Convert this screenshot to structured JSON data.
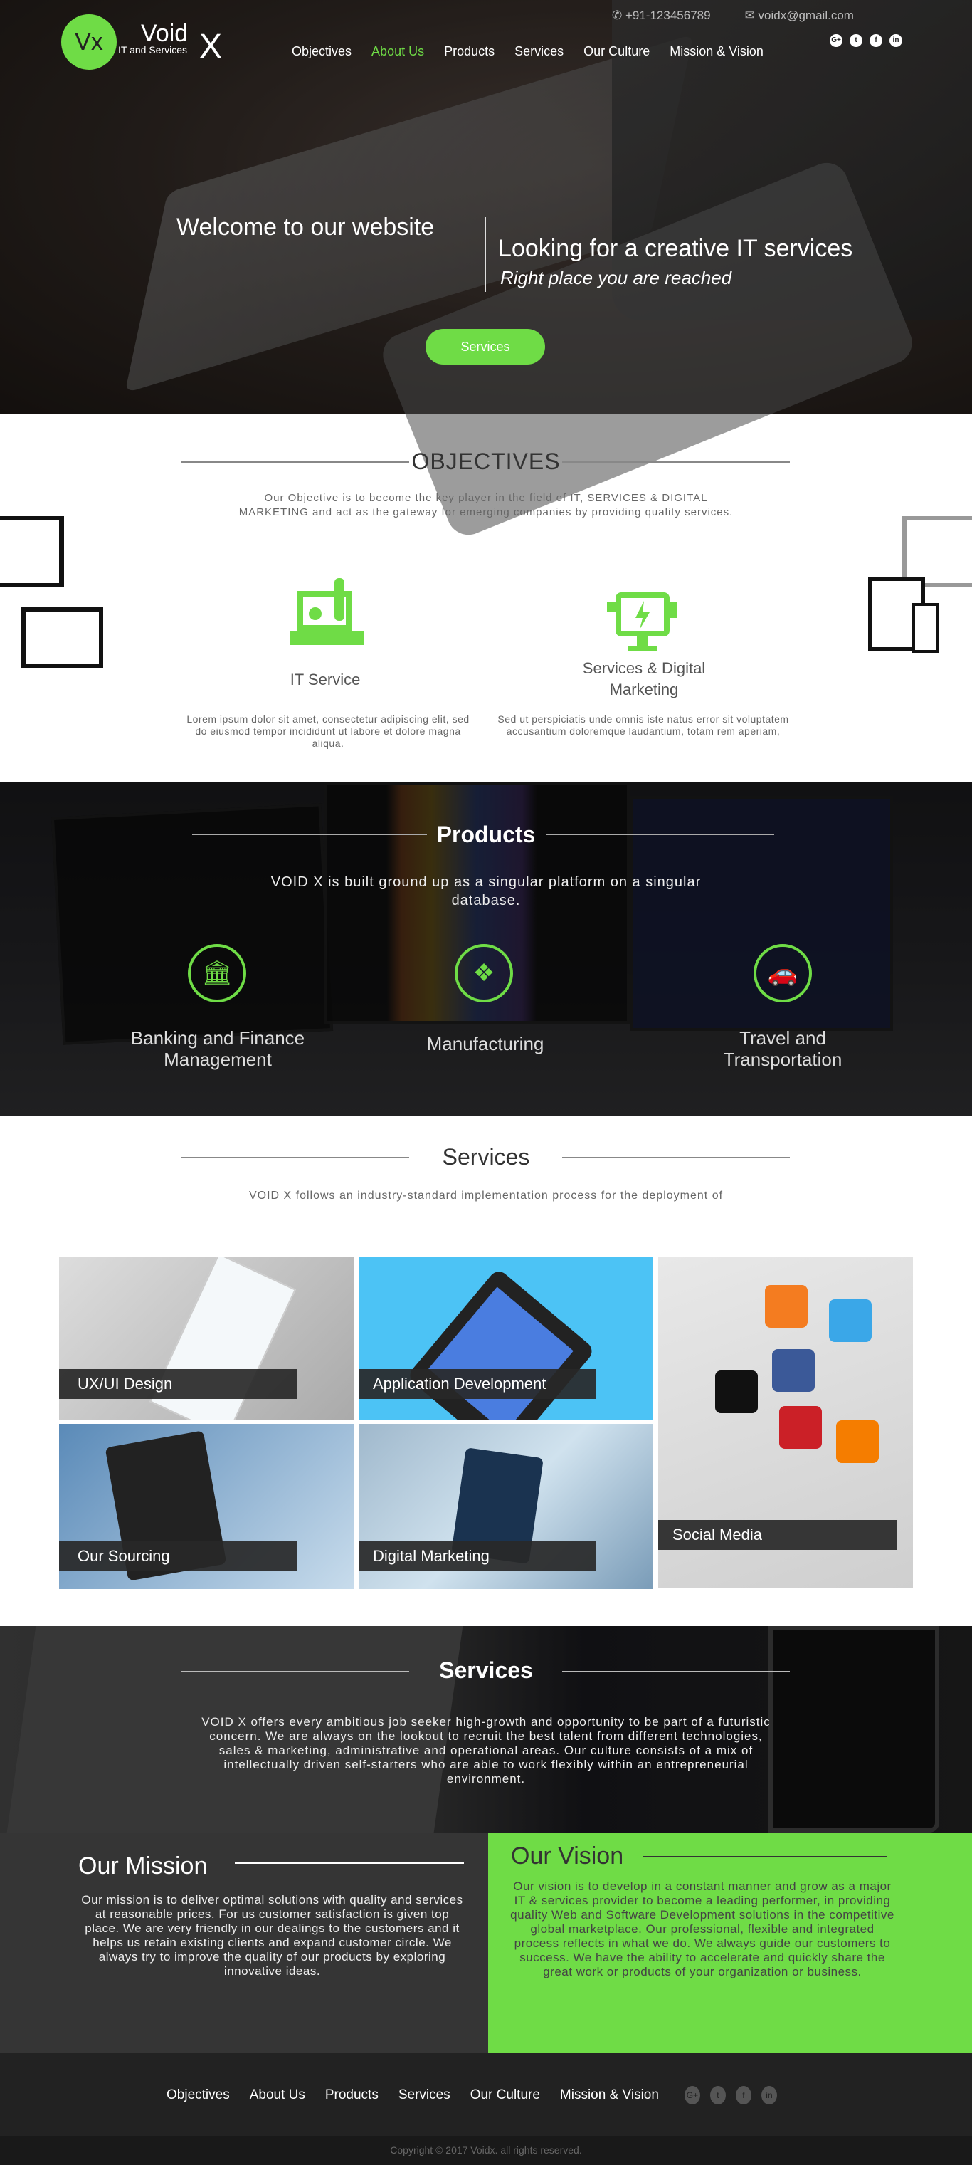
{
  "brand": {
    "logo_mark": "Vx",
    "name": "Void",
    "tagline": "IT and Services",
    "x": "X",
    "accent": "#6fdc46"
  },
  "contact": {
    "phone": "+91-123456789",
    "email": "voidx@gmail.com"
  },
  "nav": {
    "items": [
      "Objectives",
      "About Us",
      "Products",
      "Services",
      "Our Culture",
      "Mission & Vision"
    ],
    "active": "About Us"
  },
  "socials": [
    "G+",
    "t",
    "f",
    "in"
  ],
  "hero": {
    "welcome": "Welcome to our website",
    "headline": "Looking for a creative IT services",
    "subheadline": "Right place you are reached",
    "button": "Services"
  },
  "objectives": {
    "title": "OBJECTIVES",
    "text": "Our Objective is to become the key player in the field of IT, SERVICES & DIGITAL MARKETING and act as the gateway for emerging companies by providing quality services.",
    "items": [
      {
        "title": "IT Service",
        "text": "Lorem ipsum dolor sit amet, consectetur adipiscing elit, sed do eiusmod tempor incididunt ut labore et dolore magna aliqua.",
        "icon": "laptop-wrench-icon"
      },
      {
        "title": "Services & Digital Marketing",
        "text": "Sed ut perspiciatis unde omnis iste natus error sit voluptatem accusantium doloremque laudantium, totam rem aperiam,",
        "icon": "monitor-cart-mail-icon"
      }
    ]
  },
  "products": {
    "title": "Products",
    "text": "VOID X is built ground up as a singular platform on a singular database.",
    "items": [
      {
        "label": "Banking and Finance Management",
        "icon": "bank-icon"
      },
      {
        "label": "Manufacturing",
        "icon": "cubes-icon"
      },
      {
        "label": "Travel and Transportation",
        "icon": "car-icon"
      }
    ]
  },
  "services": {
    "title": "Services",
    "text": "VOID X follows an industry-standard implementation process for the deployment of",
    "tiles": [
      "UX/UI Design",
      "Application Development",
      "Social Media",
      "Our Sourcing",
      "Digital Marketing"
    ]
  },
  "culture": {
    "title": "Services",
    "text": "VOID X offers every ambitious job seeker high-growth and opportunity to be part of a futuristic concern. We are always on the lookout to recruit the best talent from different technologies, sales & marketing, administrative and operational areas. Our culture consists of a mix of intellectually driven self-starters who are able to work flexibly within an entrepreneurial environment."
  },
  "mission": {
    "title": "Our Mission",
    "text": "Our mission is to deliver optimal solutions with quality and services at reasonable prices. For us customer satisfaction is given top place. We are very friendly in our dealings to the customers and it helps us retain existing clients and expand customer circle. We always try to improve the quality of our products by exploring innovative ideas."
  },
  "vision": {
    "title": "Our Vision",
    "text": "Our vision is to develop in a constant manner and grow as a major IT & services provider to become a leading performer, in providing quality Web and Software Development solutions in the competitive global marketplace. Our professional, flexible and integrated process reflects in what we do. We always guide our customers to success. We have the ability to accelerate and quickly share the great work or products of your organization or business."
  },
  "footer": {
    "copyright": "Copyright © 2017  Voidx. all rights reserved."
  }
}
